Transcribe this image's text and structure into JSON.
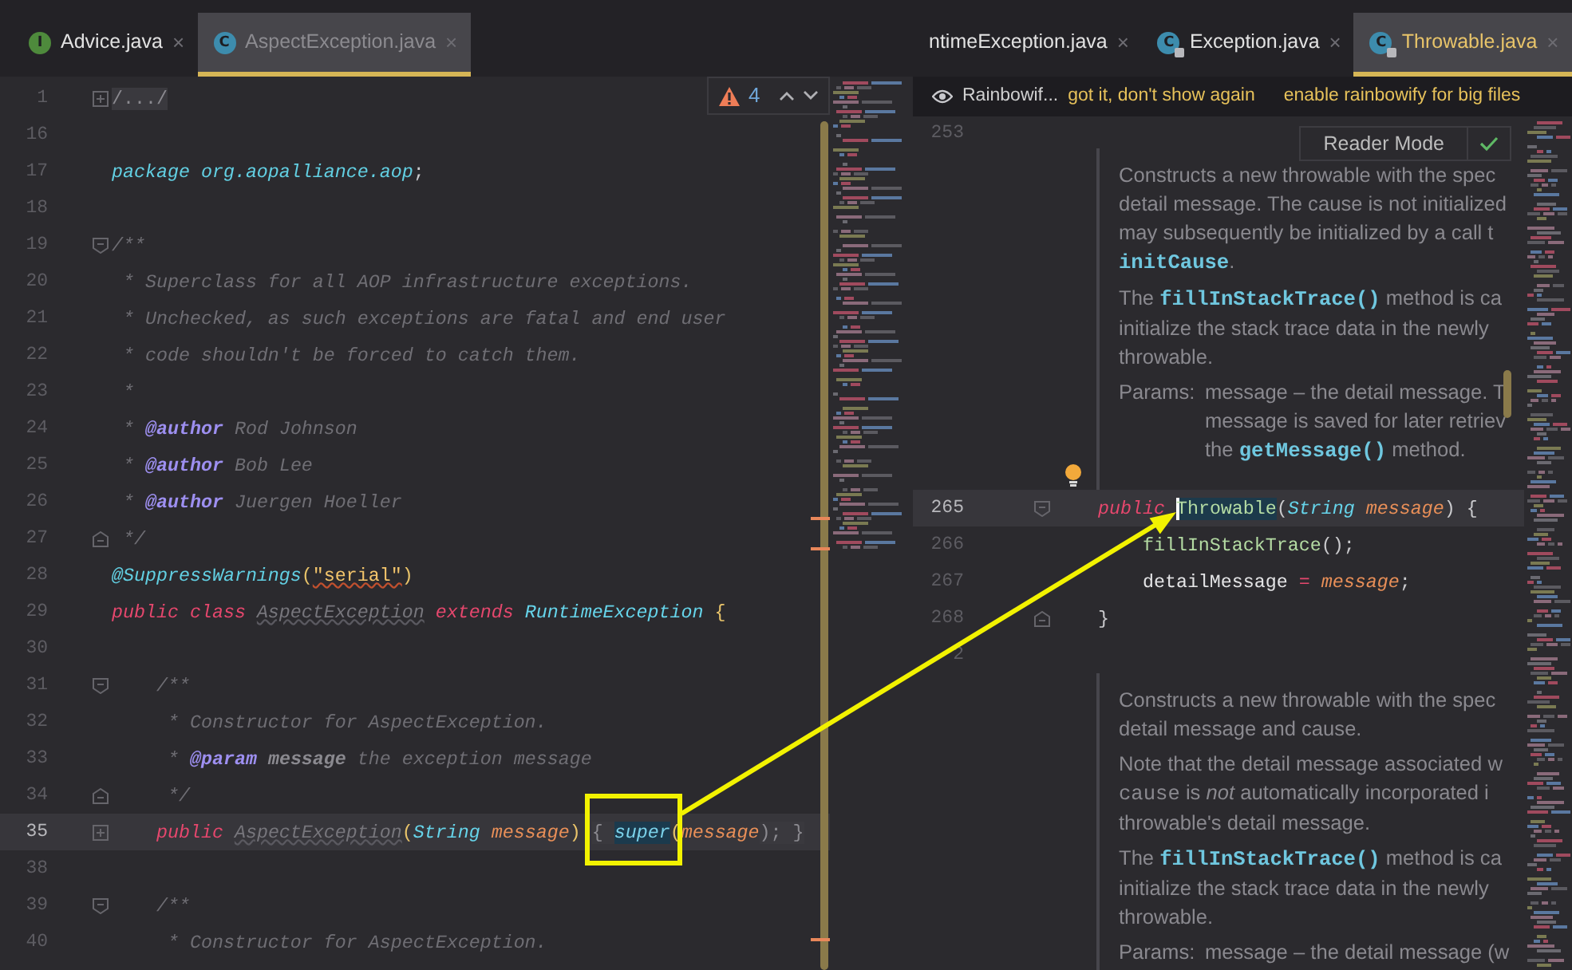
{
  "left_editor": {
    "active": false,
    "tabs": [
      {
        "label": "Advice.java",
        "kind": "interface",
        "icon_letter": "I",
        "locked": false,
        "close": "×",
        "selected": false
      },
      {
        "label": "AspectException.java",
        "kind": "class",
        "icon_letter": "C",
        "locked": false,
        "close": "×",
        "selected": true
      }
    ],
    "inspection": {
      "count": "4"
    },
    "lines": [
      {
        "number": "1",
        "current": false,
        "fold_marker": {
          "kind": "collapsed"
        },
        "tokens": [
          {
            "text": "/.../",
            "kind": "folded"
          }
        ]
      },
      {
        "number": "16",
        "current": false
      },
      {
        "number": "17",
        "current": false,
        "tokens": [
          {
            "text": "package org.aopalliance.aop",
            "kind": "pkg"
          },
          {
            "text": ";",
            "kind": "punct"
          }
        ]
      },
      {
        "number": "18",
        "current": false
      },
      {
        "number": "19",
        "current": false,
        "fold_marker": {
          "kind": "start"
        },
        "tokens": [
          {
            "text": "/**",
            "kind": "comment"
          }
        ]
      },
      {
        "number": "20",
        "current": false,
        "tokens": [
          {
            "text": " * Superclass for all AOP infrastructure exceptions.",
            "kind": "comment"
          }
        ]
      },
      {
        "number": "21",
        "current": false,
        "tokens": [
          {
            "text": " * Unchecked, as such exceptions are fatal and end user",
            "kind": "comment"
          }
        ]
      },
      {
        "number": "22",
        "current": false,
        "tokens": [
          {
            "text": " * code shouldn't be forced to catch them.",
            "kind": "comment"
          }
        ]
      },
      {
        "number": "23",
        "current": false,
        "tokens": [
          {
            "text": " *",
            "kind": "comment"
          }
        ]
      },
      {
        "number": "24",
        "current": false,
        "tokens": [
          {
            "text": " * ",
            "kind": "comment"
          },
          {
            "text": "@author",
            "kind": "tag"
          },
          {
            "text": " Rod Johnson",
            "kind": "comment"
          }
        ]
      },
      {
        "number": "25",
        "current": false,
        "tokens": [
          {
            "text": " * ",
            "kind": "comment"
          },
          {
            "text": "@author",
            "kind": "tag"
          },
          {
            "text": " Bob Lee",
            "kind": "comment"
          }
        ]
      },
      {
        "number": "26",
        "current": false,
        "tokens": [
          {
            "text": " * ",
            "kind": "comment"
          },
          {
            "text": "@author",
            "kind": "tag"
          },
          {
            "text": " Juergen Hoeller",
            "kind": "comment"
          }
        ]
      },
      {
        "number": "27",
        "current": false,
        "fold_marker": {
          "kind": "end"
        },
        "tokens": [
          {
            "text": " */",
            "kind": "comment"
          }
        ]
      },
      {
        "number": "28",
        "current": false,
        "tokens": [
          {
            "text": "@SuppressWarnings",
            "kind": "annot"
          },
          {
            "text": "(",
            "kind": "brace"
          },
          {
            "text": "\"serial\"",
            "kind": "string_warn"
          },
          {
            "text": ")",
            "kind": "brace"
          }
        ]
      },
      {
        "number": "29",
        "current": false,
        "tokens": [
          {
            "text": "public class ",
            "kind": "kw"
          },
          {
            "text": "AspectException",
            "kind": "unused"
          },
          {
            "text": " extends ",
            "kind": "kw"
          },
          {
            "text": "RuntimeException",
            "kind": "type"
          },
          {
            "text": " {",
            "kind": "brace"
          }
        ]
      },
      {
        "number": "30",
        "current": false
      },
      {
        "number": "31",
        "current": false,
        "fold_marker": {
          "kind": "start"
        },
        "tokens": [
          {
            "text": "    /**",
            "kind": "comment"
          }
        ]
      },
      {
        "number": "32",
        "current": false,
        "tokens": [
          {
            "text": "     * Constructor for AspectException.",
            "kind": "comment"
          }
        ]
      },
      {
        "number": "33",
        "current": false,
        "tokens": [
          {
            "text": "     * ",
            "kind": "comment"
          },
          {
            "text": "@param",
            "kind": "tag"
          },
          {
            "text": " message",
            "kind": "docparam"
          },
          {
            "text": " the exception message",
            "kind": "comment"
          }
        ]
      },
      {
        "number": "34",
        "current": false,
        "fold_marker": {
          "kind": "end"
        },
        "tokens": [
          {
            "text": "     */",
            "kind": "comment"
          }
        ]
      },
      {
        "number": "35",
        "current": true,
        "fold_marker": {
          "kind": "collapsed"
        },
        "tokens": [
          {
            "text": "    public ",
            "kind": "kw"
          },
          {
            "text": "AspectException",
            "kind": "unused"
          },
          {
            "text": "(",
            "kind": "brace"
          },
          {
            "text": "String",
            "kind": "type"
          },
          {
            "text": " message",
            "kind": "param"
          },
          {
            "text": ") ",
            "kind": "brace"
          },
          {
            "text": "{ ",
            "kind": "fold_region"
          },
          {
            "text": "super",
            "kind": "super"
          },
          {
            "text": "(",
            "kind": "brace"
          },
          {
            "text": "message",
            "kind": "param"
          },
          {
            "text": "); }",
            "kind": "fold_region"
          }
        ]
      },
      {
        "number": "38",
        "current": false
      },
      {
        "number": "39",
        "current": false,
        "fold_marker": {
          "kind": "start"
        },
        "tokens": [
          {
            "text": "    /**",
            "kind": "comment"
          }
        ]
      },
      {
        "number": "40",
        "current": false,
        "tokens": [
          {
            "text": "     * Constructor for AspectException.",
            "kind": "comment"
          }
        ]
      }
    ]
  },
  "right_editor": {
    "active": true,
    "tabs": [
      {
        "label": "ntimeException.java",
        "close": "×",
        "selected": false
      },
      {
        "label": "Exception.java",
        "kind": "class",
        "icon_letter": "C",
        "locked": true,
        "close": "×",
        "selected": false
      },
      {
        "label": "Throwable.java",
        "kind": "class",
        "icon_letter": "C",
        "locked": true,
        "close": "×",
        "selected": true
      }
    ],
    "notification": {
      "title": "Rainbowif...",
      "actions": [
        "got it, don't show again",
        "enable rainbowify for big files"
      ]
    },
    "reader_mode": {
      "label": "Reader Mode"
    },
    "items": [
      {
        "kind": "line",
        "number": "253",
        "current": false,
        "bulb": false
      },
      {
        "kind": "doc",
        "paragraphs": [
          {
            "lines": [
              [
                {
                  "text": "Constructs a new throwable with the spec",
                  "kind": "text"
                }
              ],
              [
                {
                  "text": "detail message. The cause is not initialized",
                  "kind": "text"
                }
              ],
              [
                {
                  "text": "may subsequently be initialized by a call t",
                  "kind": "text"
                }
              ],
              [
                {
                  "text": "initCause",
                  "kind": "link"
                },
                {
                  "text": ".",
                  "kind": "text"
                }
              ]
            ]
          },
          {
            "lines": [
              [
                {
                  "text": "The ",
                  "kind": "text"
                },
                {
                  "text": "fillInStackTrace()",
                  "kind": "link"
                },
                {
                  "text": " method is ca",
                  "kind": "text"
                }
              ],
              [
                {
                  "text": "initialize the stack trace data in the newly",
                  "kind": "text"
                }
              ],
              [
                {
                  "text": "throwable.",
                  "kind": "text"
                }
              ]
            ]
          },
          {
            "label": "Params:",
            "lines": [
              [
                {
                  "text": "message – the detail message. T",
                  "kind": "text"
                }
              ],
              [
                {
                  "text": "message is saved for later retriev",
                  "kind": "text"
                }
              ],
              [
                {
                  "text": "the ",
                  "kind": "text"
                },
                {
                  "text": "getMessage()",
                  "kind": "link"
                },
                {
                  "text": " method.",
                  "kind": "text"
                }
              ]
            ]
          }
        ]
      },
      {
        "kind": "line",
        "number": "265",
        "current": true,
        "bulb": true,
        "fold_marker": {
          "kind": "start"
        },
        "tokens": [
          {
            "text": "    public ",
            "kind": "kw"
          },
          {
            "text": "Throwable",
            "kind": "ident_caret"
          },
          {
            "text": "(",
            "kind": "punct"
          },
          {
            "text": "String",
            "kind": "type"
          },
          {
            "text": " message",
            "kind": "param"
          },
          {
            "text": ") {",
            "kind": "punct"
          }
        ]
      },
      {
        "kind": "line",
        "number": "266",
        "current": false,
        "bulb": false,
        "tokens": [
          {
            "text": "        fillInStackTrace",
            "kind": "method"
          },
          {
            "text": "();",
            "kind": "punct"
          }
        ]
      },
      {
        "kind": "line",
        "number": "267",
        "current": false,
        "bulb": false,
        "tokens": [
          {
            "text": "        detailMessage",
            "kind": "field"
          },
          {
            "text": " = ",
            "kind": "op"
          },
          {
            "text": "message",
            "kind": "param"
          },
          {
            "text": ";",
            "kind": "punct"
          }
        ]
      },
      {
        "kind": "line",
        "number": "268",
        "current": false,
        "bulb": false,
        "fold_marker": {
          "kind": "end"
        },
        "tokens": [
          {
            "text": "    }",
            "kind": "punct"
          }
        ]
      },
      {
        "kind": "line",
        "number": "2",
        "current": false,
        "bulb": false
      },
      {
        "kind": "doc",
        "paragraphs": [
          {
            "lines": [
              [
                {
                  "text": "Constructs a new throwable with the spec",
                  "kind": "text"
                }
              ],
              [
                {
                  "text": "detail message and cause.",
                  "kind": "text"
                }
              ]
            ]
          },
          {
            "lines": [
              [
                {
                  "text": "Note that the detail message associated w",
                  "kind": "text"
                }
              ],
              [
                {
                  "text": "cause",
                  "kind": "code"
                },
                {
                  "text": " is ",
                  "kind": "text"
                },
                {
                  "text": "not",
                  "kind": "em"
                },
                {
                  "text": " automatically incorporated i",
                  "kind": "text"
                }
              ],
              [
                {
                  "text": "throwable's detail message.",
                  "kind": "text"
                }
              ]
            ]
          },
          {
            "lines": [
              [
                {
                  "text": "The ",
                  "kind": "text"
                },
                {
                  "text": "fillInStackTrace()",
                  "kind": "link"
                },
                {
                  "text": " method is ca",
                  "kind": "text"
                }
              ],
              [
                {
                  "text": "initialize the stack trace data in the newly",
                  "kind": "text"
                }
              ],
              [
                {
                  "text": "throwable.",
                  "kind": "text"
                }
              ]
            ]
          },
          {
            "label": "Params:",
            "lines": [
              [
                {
                  "text": "message – the detail message (w",
                  "kind": "text"
                }
              ]
            ]
          }
        ]
      }
    ]
  }
}
